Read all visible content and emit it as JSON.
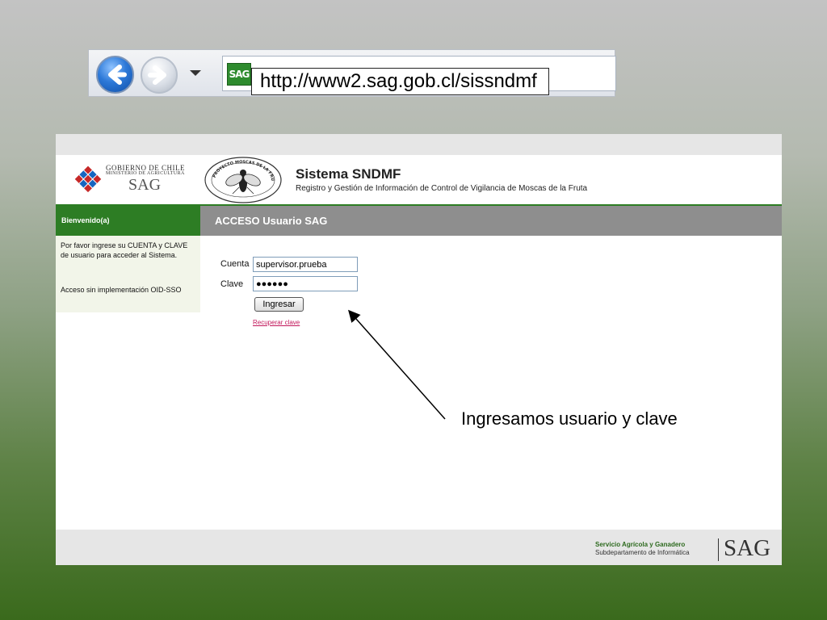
{
  "browser": {
    "favicon_text": "SAG",
    "url": "http://www2.sag.gob.cl/sissndmf",
    "icons": [
      "back-arrow-icon",
      "forward-arrow-icon",
      "dropdown-arrow-icon"
    ],
    "colors": {
      "back": "#2d79d8",
      "forward": "#d9dee6",
      "favicon": "#2e8b2e"
    }
  },
  "header": {
    "gob_title": "GOBIERNO DE CHILE",
    "gob_subtitle": "MINISTERIO DE AGRICULTURA",
    "gob_sag": "SAG",
    "seal_text": "PROYECTO MOSCAS DE LA FRUTA",
    "system_title": "Sistema SNDMF",
    "system_subtitle": "Registro y Gestión de Información de Control de Vigilancia de Moscas de la Fruta"
  },
  "sidebar": {
    "heading": "Bienvenido(a)",
    "text": "Por favor ingrese su CUENTA y CLAVE de usuario para acceder al Sistema.",
    "text2": "Acceso sin implementación OID-SSO"
  },
  "main": {
    "heading": "ACCESO Usuario SAG",
    "account_label": "Cuenta",
    "account_value": "supervisor.prueba",
    "password_label": "Clave",
    "password_value": "●●●●●●",
    "submit_label": "Ingresar",
    "recover_link": "Recuperar clave"
  },
  "footer": {
    "org": "Servicio Agrícola y Ganadero",
    "dept": "Subdepartamento de Informática",
    "logo": "SAG"
  },
  "annotation": {
    "text": "Ingresamos usuario y clave"
  },
  "colors": {
    "brand_green": "#2d7d24",
    "section_gray": "#8e8e8e",
    "link": "#c2185b"
  }
}
